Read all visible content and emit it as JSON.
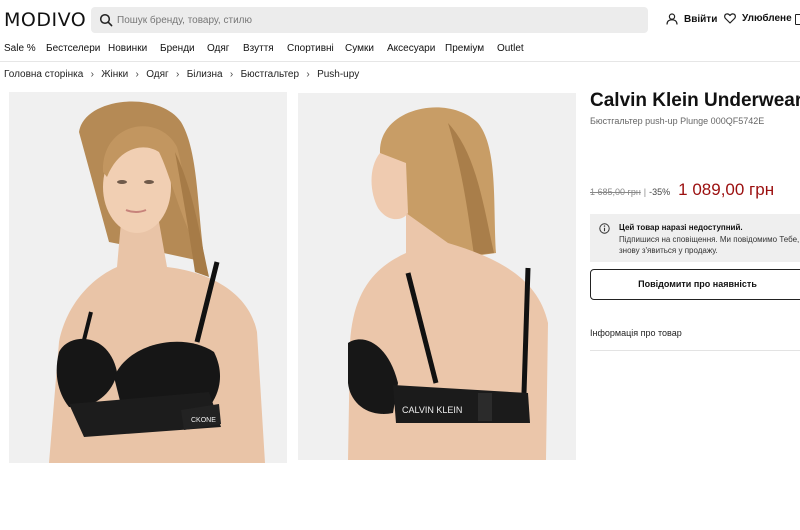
{
  "header": {
    "logo": "MODIVO",
    "search_placeholder": "Пошук бренду, товару, стилю",
    "login_label": "Ввійти",
    "favorites_label": "Улюблене"
  },
  "nav": {
    "items": [
      "Sale %",
      "Бестселери",
      "Новинки",
      "Бренди",
      "Одяг",
      "Взуття",
      "Спортивні",
      "Сумки",
      "Аксесуари",
      "Преміум",
      "Outlet"
    ]
  },
  "breadcrumb": [
    "Головна сторінка",
    "Жінки",
    "Одяг",
    "Білизна",
    "Бюстгальтер",
    "Push-upy"
  ],
  "product": {
    "brand": "Calvin Klein Underwear",
    "subtitle": "Бюстгальтер push-up Plunge 000QF5742E",
    "old_price": "1 685,00 грн",
    "separator": "|",
    "discount": "-35%",
    "new_price": "1 089,00 грн",
    "notice_title": "Цей товар наразі недоступний.",
    "notice_line1": "Підпишися на сповіщення. Ми повідомимо Тебе, кол",
    "notice_line2": "знову з'явиться у продажу.",
    "notify_button": "Повідомити про наявність",
    "info_link": "Інформація про товар",
    "band_text_front": "CKONE",
    "band_text_back": "CALVIN KLEIN"
  },
  "colors": {
    "accent_price": "#9b0f0f",
    "search_bg": "#ececec",
    "notice_bg": "#efefef",
    "photo_bg": "#f0f0f0"
  },
  "icons": {
    "search": "search-icon",
    "login": "user-icon",
    "favorites": "heart-icon",
    "cart": "bag-icon",
    "breadcrumb_separator": "chevron-right-icon",
    "notice": "info-icon"
  }
}
